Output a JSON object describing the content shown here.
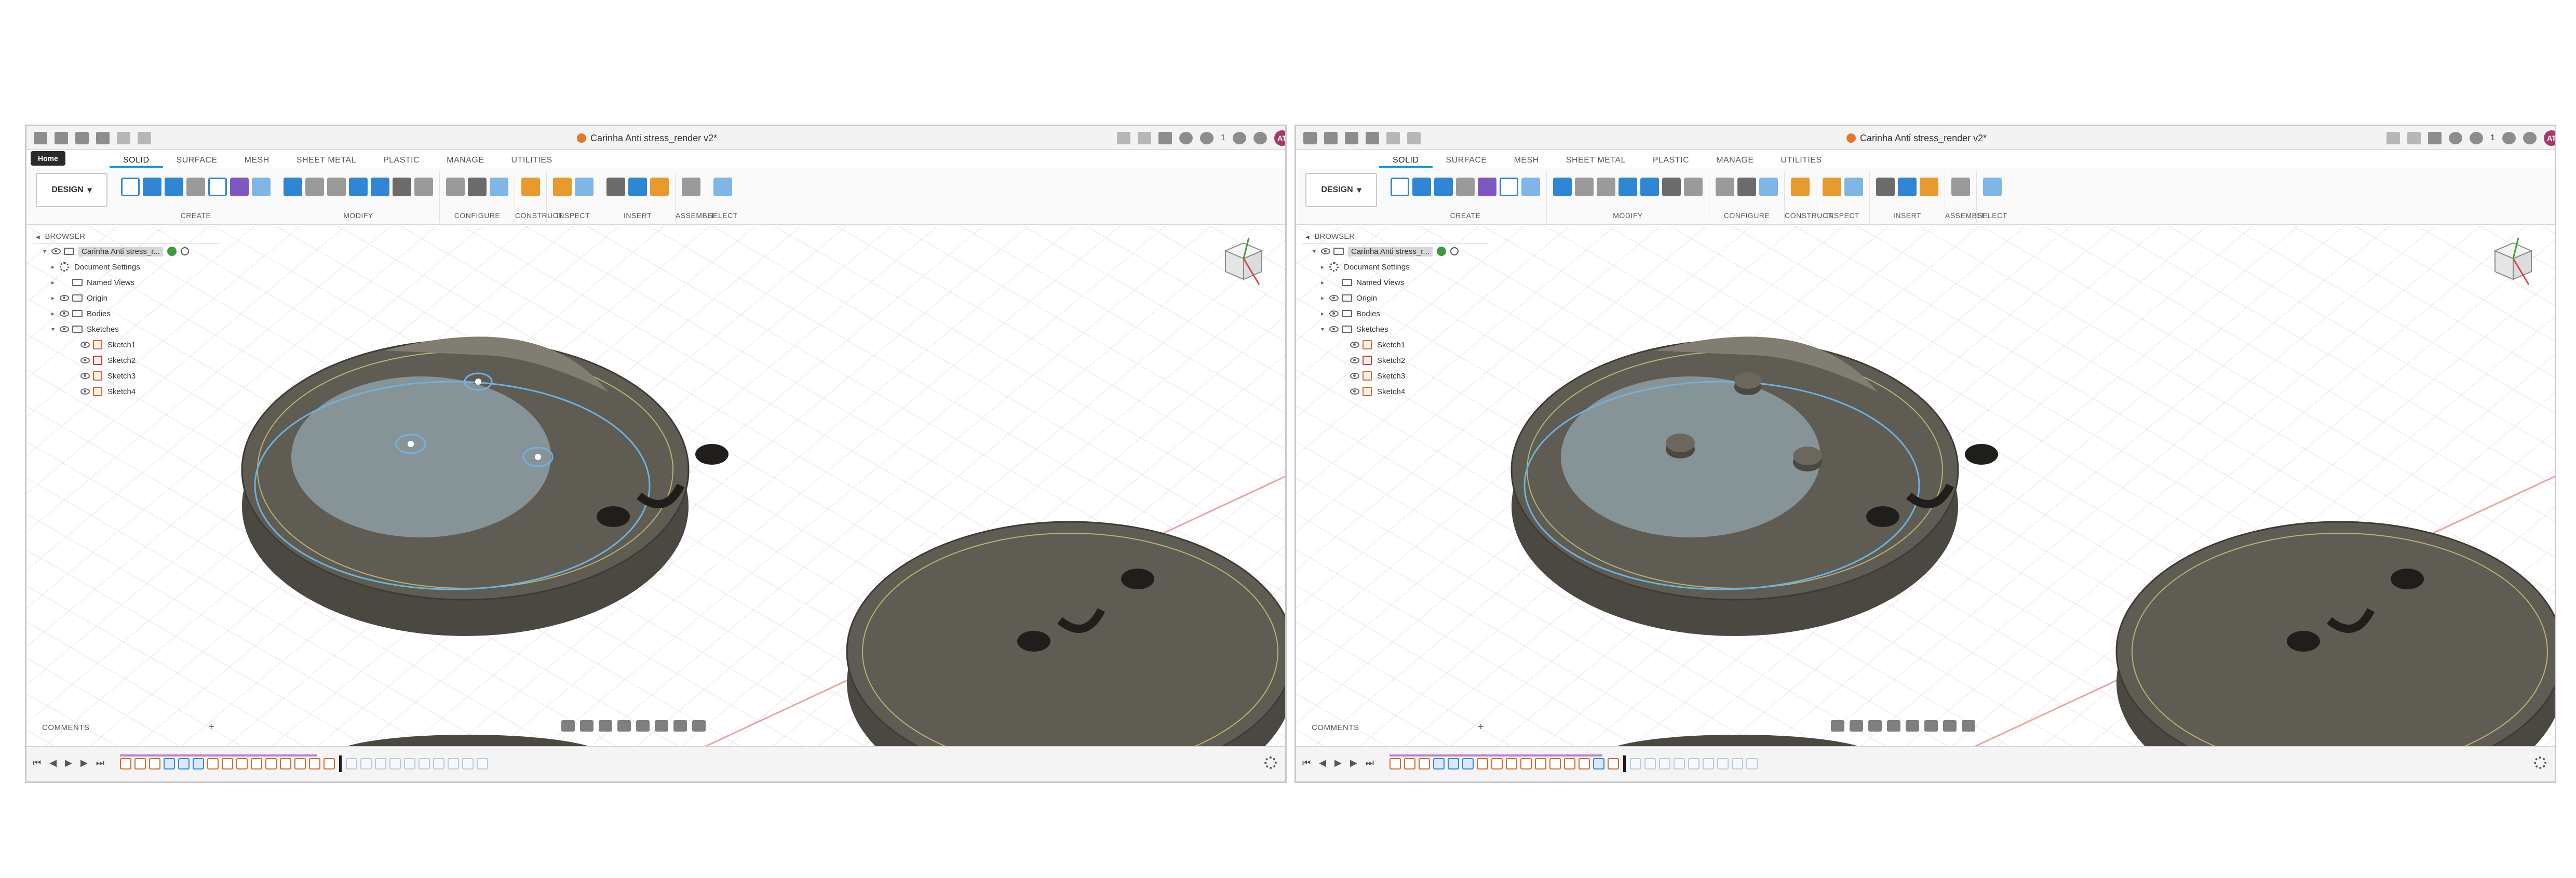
{
  "windows": [
    {
      "id": "left",
      "title": "Carinha Anti stress_render v2*",
      "home_tooltip": "Home",
      "workspace": "DESIGN",
      "tabs": [
        "SOLID",
        "SURFACE",
        "MESH",
        "SHEET METAL",
        "PLASTIC",
        "MANAGE",
        "UTILITIES"
      ],
      "active_tab": "SOLID",
      "groups": [
        "CREATE",
        "MODIFY",
        "CONFIGURE",
        "CONSTRUCT",
        "INSPECT",
        "INSERT",
        "ASSEMBLE",
        "SELECT"
      ],
      "browser": {
        "header": "BROWSER",
        "root": "Carinha Anti stress_r...",
        "items": [
          "Document Settings",
          "Named Views",
          "Origin",
          "Bodies",
          "Sketches"
        ],
        "sketches": [
          "Sketch1",
          "Sketch2",
          "Sketch3",
          "Sketch4"
        ]
      },
      "comments": "COMMENTS",
      "user_initials": "AT",
      "notification_count": "1"
    },
    {
      "id": "right",
      "title": "Carinha Anti stress_render v2*",
      "workspace": "DESIGN",
      "tabs": [
        "SOLID",
        "SURFACE",
        "MESH",
        "SHEET METAL",
        "PLASTIC",
        "MANAGE",
        "UTILITIES"
      ],
      "active_tab": "SOLID",
      "groups": [
        "CREATE",
        "MODIFY",
        "CONFIGURE",
        "CONSTRUCT",
        "INSPECT",
        "INSERT",
        "ASSEMBLE",
        "SELECT"
      ],
      "browser": {
        "header": "BROWSER",
        "root": "Carinha Anti stress_r...",
        "items": [
          "Document Settings",
          "Named Views",
          "Origin",
          "Bodies",
          "Sketches"
        ],
        "sketches": [
          "Sketch1",
          "Sketch2",
          "Sketch3",
          "Sketch4"
        ]
      },
      "comments": "COMMENTS",
      "user_initials": "AT",
      "notification_count": "1"
    }
  ],
  "colors": {
    "accent": "#0696d7",
    "body_fill": "#5f5c53",
    "body_rim": "#4a4841",
    "sketch_line": "#6fb2e0",
    "doc_icon": "#e8772e",
    "avatar": "#a33a6e"
  }
}
